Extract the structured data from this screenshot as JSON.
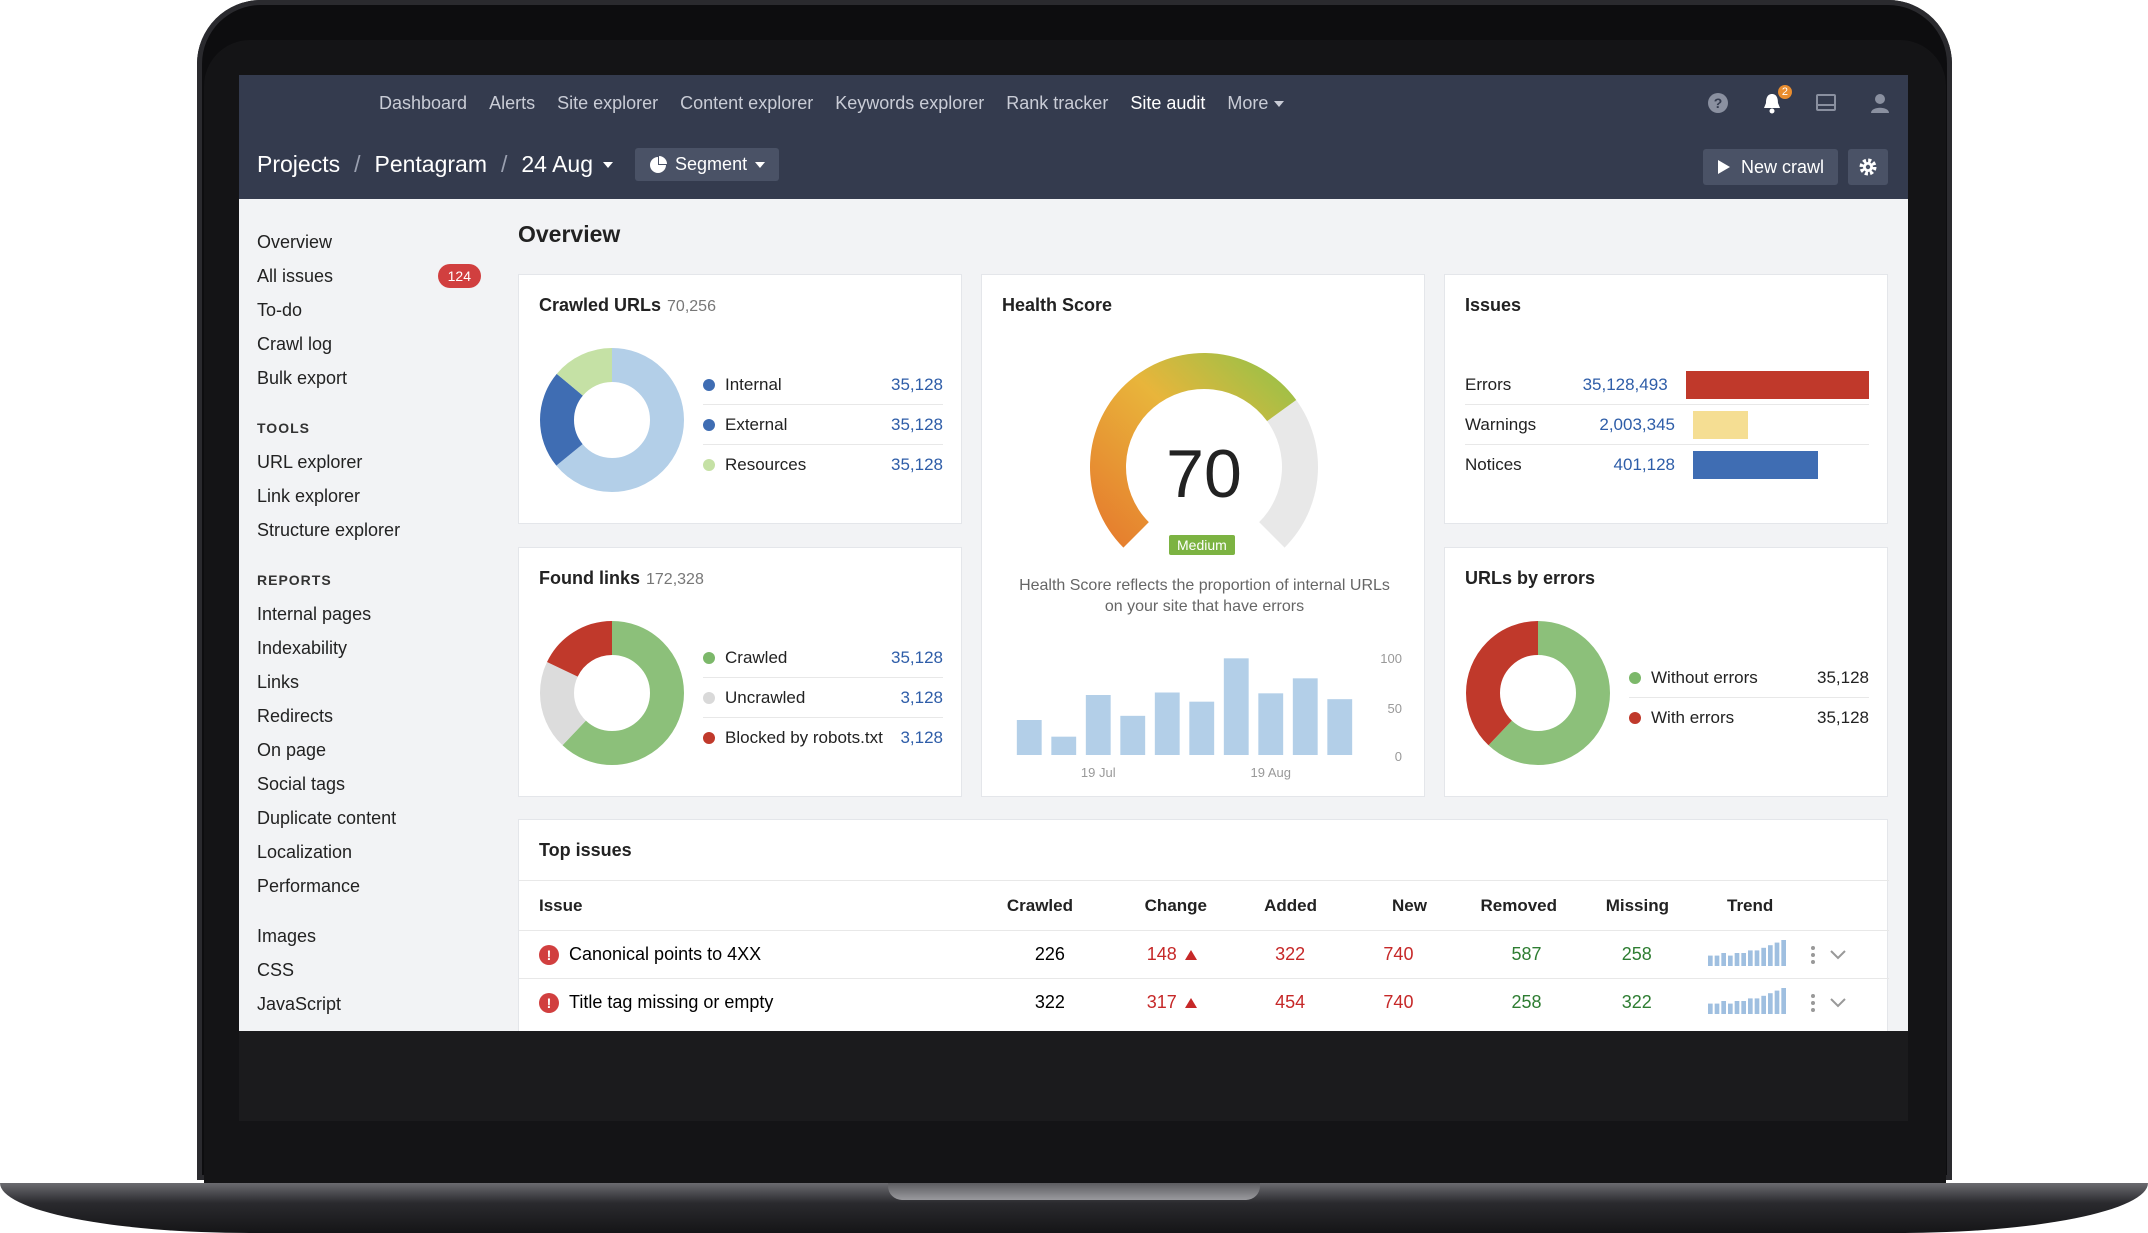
{
  "nav": {
    "links": [
      "Dashboard",
      "Alerts",
      "Site explorer",
      "Content explorer",
      "Keywords explorer",
      "Rank tracker",
      "Site audit",
      "More"
    ],
    "active": "Site audit",
    "notification_count": "2"
  },
  "breadcrumb": {
    "projects": "Projects",
    "project": "Pentagram",
    "crawl": "24 Aug",
    "separator": "/"
  },
  "segment_label": "Segment",
  "new_crawl_label": "New crawl",
  "sidebar": {
    "top": [
      {
        "label": "Overview",
        "badge": ""
      },
      {
        "label": "All issues",
        "badge": "124"
      },
      {
        "label": "To-do",
        "badge": ""
      },
      {
        "label": "Crawl log",
        "badge": ""
      },
      {
        "label": "Bulk export",
        "badge": ""
      }
    ],
    "tools_heading": "TOOLS",
    "tools": [
      "URL explorer",
      "Link explorer",
      "Structure explorer"
    ],
    "reports_heading": "REPORTS",
    "reports": [
      "Internal pages",
      "Indexability",
      "Links",
      "Redirects",
      "On page",
      "Social tags",
      "Duplicate content",
      "Localization",
      "Performance"
    ],
    "resources": [
      "Images",
      "CSS",
      "JavaScript"
    ]
  },
  "page_title": "Overview",
  "crawled_urls": {
    "title": "Crawled URLs",
    "count": "70,256",
    "items": [
      {
        "label": "Internal",
        "value": "35,128",
        "color": "#3f6db3"
      },
      {
        "label": "External",
        "value": "35,128",
        "color": "#3f6db3"
      },
      {
        "label": "Resources",
        "value": "35,128",
        "color": "#c5e1a5"
      }
    ],
    "donut": [
      {
        "share": 0.64,
        "color": "#b3cfe8"
      },
      {
        "share": 0.22,
        "color": "#3f6db3"
      },
      {
        "share": 0.14,
        "color": "#c5e1a5"
      }
    ]
  },
  "found_links": {
    "title": "Found links",
    "count": "172,328",
    "items": [
      {
        "label": "Crawled",
        "value": "35,128",
        "color": "#7cb86a"
      },
      {
        "label": "Uncrawled",
        "value": "3,128",
        "color": "#d9d9d9"
      },
      {
        "label": "Blocked by robots.txt",
        "value": "3,128",
        "color": "#c0392b"
      }
    ],
    "donut": [
      {
        "share": 0.62,
        "color": "#8cc07a"
      },
      {
        "share": 0.2,
        "color": "#dcdcdc"
      },
      {
        "share": 0.18,
        "color": "#c0392b"
      }
    ]
  },
  "health": {
    "title": "Health Score",
    "score": "70",
    "score_value": 70,
    "label": "Medium",
    "description": "Health Score reflects the proportion of internal URLs on your site that have errors",
    "chart_data": {
      "type": "bar",
      "values": [
        42,
        22,
        72,
        47,
        75,
        64,
        116,
        74,
        92,
        67
      ],
      "y_ticks": [
        "100",
        "50",
        "0"
      ],
      "x_ticks": [
        "19 Jul",
        "19 Aug"
      ],
      "ylim": [
        0,
        120
      ]
    }
  },
  "issues": {
    "title": "Issues",
    "rows": [
      {
        "label": "Errors",
        "value": "35,128,493",
        "share": 1.0,
        "color": "#c0392b"
      },
      {
        "label": "Warnings",
        "value": "2,003,345",
        "share": 0.29,
        "color": "#f5de93"
      },
      {
        "label": "Notices",
        "value": "401,128",
        "share": 0.66,
        "color": "#3f6db3"
      }
    ]
  },
  "urls_by_errors": {
    "title": "URLs by errors",
    "items": [
      {
        "label": "Without errors",
        "value": "35,128",
        "color": "#7cb86a"
      },
      {
        "label": "With errors",
        "value": "35,128",
        "color": "#c0392b"
      }
    ],
    "donut": [
      {
        "share": 0.62,
        "color": "#8cc07a"
      },
      {
        "share": 0.38,
        "color": "#c0392b"
      }
    ]
  },
  "top_issues": {
    "title": "Top issues",
    "columns": [
      "Issue",
      "Crawled",
      "Change",
      "Added",
      "New",
      "Removed",
      "Missing",
      "Trend"
    ],
    "rows": [
      {
        "issue": "Canonical points to 4XX",
        "crawled": "226",
        "change": "148",
        "added": "322",
        "new": "740",
        "removed": "587",
        "missing": "258"
      },
      {
        "issue": "Title tag missing or empty",
        "crawled": "322",
        "change": "317",
        "added": "454",
        "new": "740",
        "removed": "258",
        "missing": "322"
      }
    ],
    "trend_values": [
      4,
      4,
      5,
      4,
      5,
      5,
      6,
      6,
      7,
      8,
      9,
      10
    ]
  }
}
